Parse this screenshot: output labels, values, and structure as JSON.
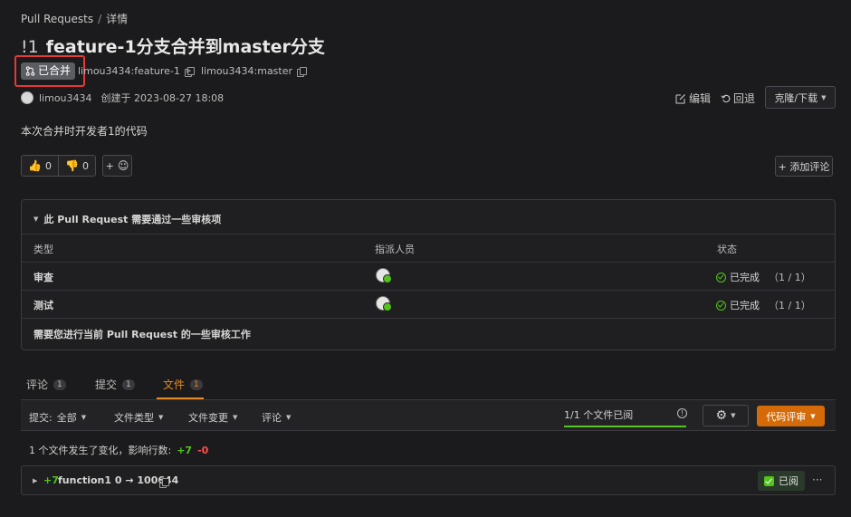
{
  "breadcrumb": {
    "root": "Pull Requests",
    "separator": "/",
    "current": "详情"
  },
  "pr": {
    "number": "!1",
    "title": "feature-1分支合并到master分支",
    "status": "已合并",
    "source_branch": "limou3434:feature-1",
    "target_branch": "limou3434:master",
    "author": "limou3434",
    "created": "创建于 2023-08-27 18:08",
    "description": "本次合并时开发者1的代码"
  },
  "actions": {
    "edit": "编辑",
    "revert": "回退",
    "clone": "克隆/下载",
    "thumbs_up": "0",
    "thumbs_down": "0",
    "add_reaction": "+",
    "add_comment": "+ 添加评论"
  },
  "review_panel": {
    "header": "此 Pull Request 需要通过一些审核项",
    "columns": [
      "类型",
      "指派人员",
      "状态"
    ],
    "rows": [
      {
        "type": "审查",
        "status": "已完成",
        "progress": "（1 / 1）"
      },
      {
        "type": "测试",
        "status": "已完成",
        "progress": "（1 / 1）"
      }
    ],
    "footer": "需要您进行当前 Pull Request 的一些审核工作"
  },
  "tabs": [
    {
      "label": "评论",
      "count": "1"
    },
    {
      "label": "提交",
      "count": "1"
    },
    {
      "label": "文件",
      "count": "1"
    }
  ],
  "toolbar": {
    "commit_label": "提交:",
    "commit_value": "全部",
    "file_type": "文件类型",
    "file_change": "文件变更",
    "comment": "评论",
    "review_progress": "1/1 个文件已阅",
    "review_progress_fraction": 1.0,
    "code_review": "代码评审"
  },
  "summary": {
    "text": "1 个文件发生了变化，影响行数:",
    "added": "+7",
    "removed": "-0"
  },
  "file": {
    "added": "+7",
    "name": "function1 0 → 100644",
    "viewed": "已阅",
    "more": "···"
  },
  "colors": {
    "accent": "#e68a1f",
    "success": "#52c41a",
    "danger": "#ff4d4f",
    "highlight": "#e53935"
  }
}
